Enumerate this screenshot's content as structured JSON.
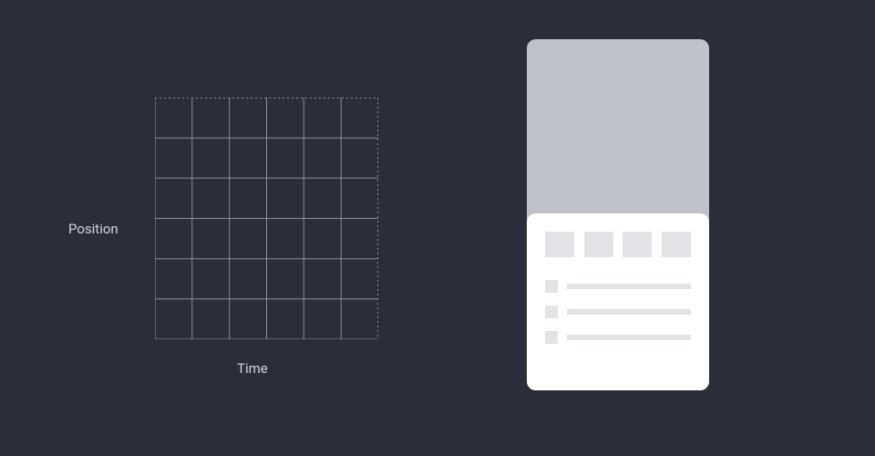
{
  "chart": {
    "y_axis_label": "Position",
    "x_axis_label": "Time",
    "grid": {
      "columns": 6,
      "rows": 6
    }
  },
  "mockup": {
    "tabs": [
      "",
      "",
      "",
      ""
    ],
    "list_items": [
      "",
      "",
      ""
    ]
  }
}
